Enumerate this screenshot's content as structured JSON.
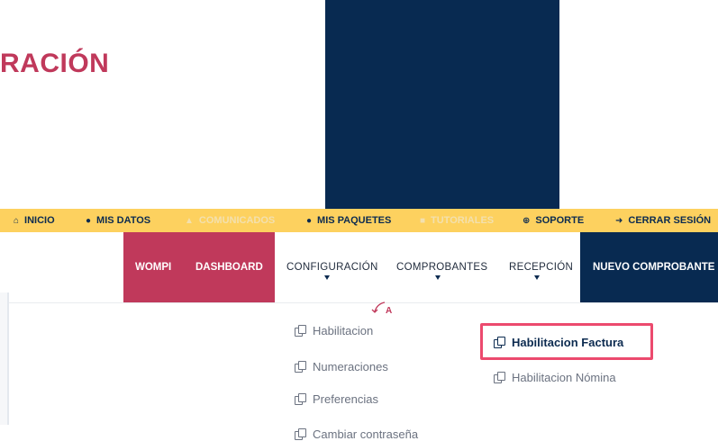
{
  "page": {
    "title": "RACIÓN"
  },
  "topbar": {
    "items": [
      {
        "label": "INICIO",
        "icon": "home-icon",
        "glyph": "⌂"
      },
      {
        "label": "MIS DATOS",
        "icon": "info-icon",
        "glyph": "●"
      },
      {
        "label": "COMUNICADOS",
        "icon": "bell-icon",
        "glyph": "▲"
      },
      {
        "label": "MIS PAQUETES",
        "icon": "info-icon",
        "glyph": "●"
      },
      {
        "label": "TUTORIALES",
        "icon": "video-icon",
        "glyph": "■"
      },
      {
        "label": "SOPORTE",
        "icon": "lifebuoy-icon",
        "glyph": "⊕"
      },
      {
        "label": "CERRAR SESIÓN",
        "icon": "logout-icon",
        "glyph": "➜"
      }
    ]
  },
  "nav": {
    "items": [
      {
        "label": "WOMPI"
      },
      {
        "label": "DASHBOARD"
      },
      {
        "label": "CONFIGURACIÓN"
      },
      {
        "label": "COMPROBANTES"
      },
      {
        "label": "RECEPCIÓN"
      },
      {
        "label": "NUEVO COMPROBANTE"
      }
    ]
  },
  "dropdown": {
    "items": [
      {
        "label": "Habilitacion"
      },
      {
        "label": "Numeraciones"
      },
      {
        "label": "Preferencias"
      },
      {
        "label": "Cambiar contraseña"
      }
    ]
  },
  "annotation": {
    "label": "A"
  },
  "submenu": {
    "items": [
      {
        "label": "Habilitacion Factura"
      },
      {
        "label": "Habilitacion Nómina"
      }
    ]
  },
  "colors": {
    "brand_pink": "#c0395b",
    "brand_navy": "#082a51",
    "topbar_yellow": "#fdd15f",
    "highlight_pink": "#ec4a6e"
  }
}
